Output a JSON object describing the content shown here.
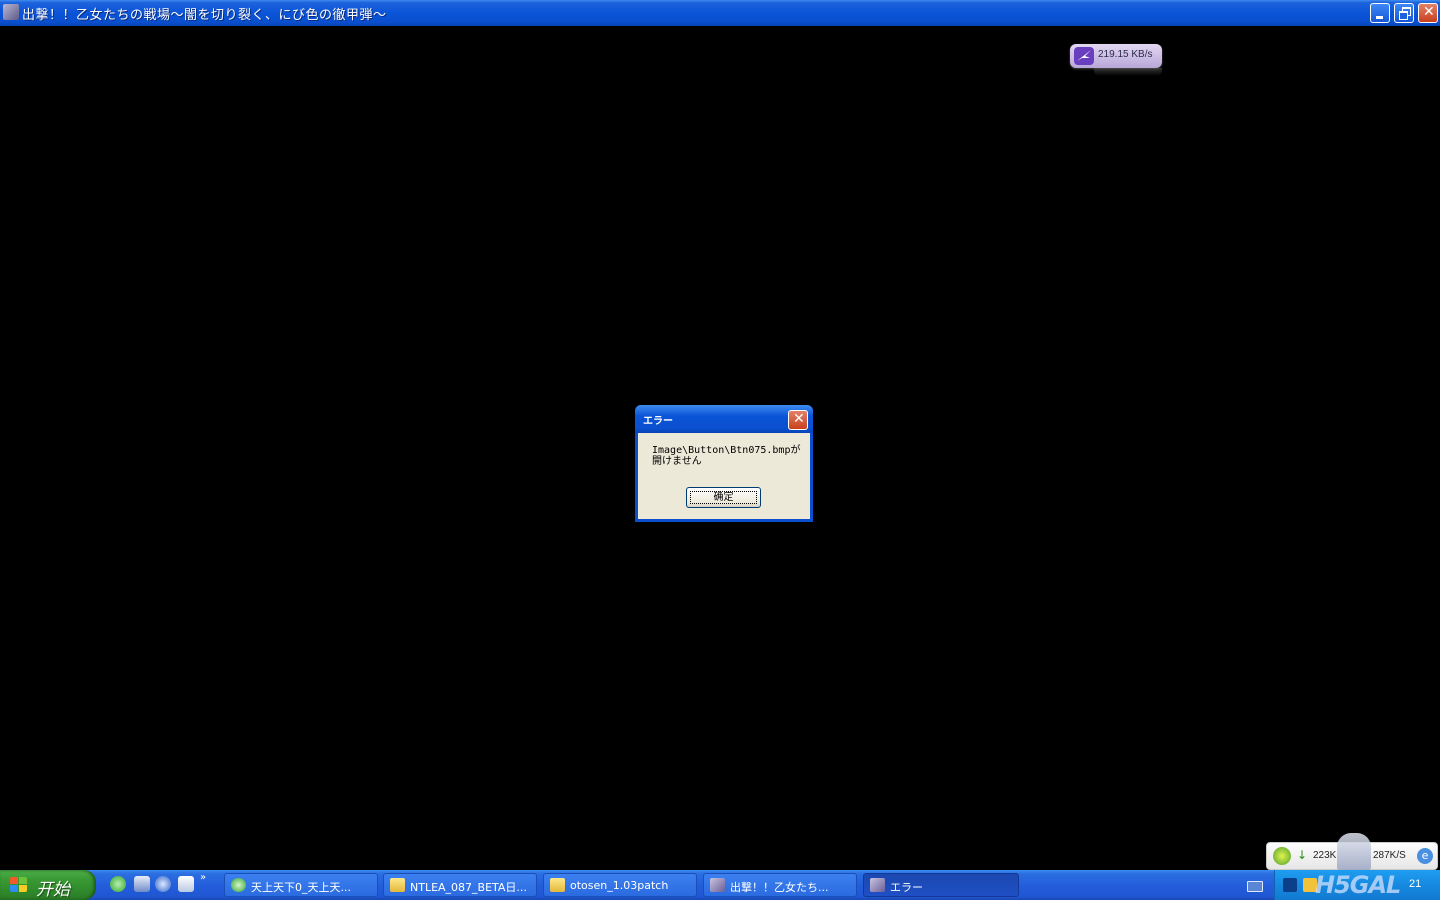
{
  "window": {
    "title": "出撃！！乙女たちの戦場～闇を切り裂く、にび色の徹甲弾～"
  },
  "speed_widget": {
    "value": "219.15 KB/s"
  },
  "dialog": {
    "title": "エラー",
    "message_line1": "Image\\Button\\Btn075.bmpが",
    "message_line2": "開けません",
    "ok_label": "确定"
  },
  "net_widget": {
    "download": "223K",
    "upload": "287K/S"
  },
  "taskbar": {
    "start_label": "开始",
    "quicklaunch_more": "»",
    "tasks": [
      {
        "label": "天上天下0_天上天...",
        "icon": "browser-icon"
      },
      {
        "label": "NTLEA_087_BETA日...",
        "icon": "folder-icon"
      },
      {
        "label": "otosen_1.03patch",
        "icon": "folder-icon"
      },
      {
        "label": "出撃！！乙女たち...",
        "icon": "game-icon"
      },
      {
        "label": "エラー",
        "icon": "game-icon"
      }
    ],
    "tray": {
      "watermark": "H5GAL",
      "clock": "21"
    }
  },
  "colors": {
    "xp_blue": "#0a54d8",
    "start_green": "#3a9a35",
    "dialog_body": "#ece9d8"
  }
}
